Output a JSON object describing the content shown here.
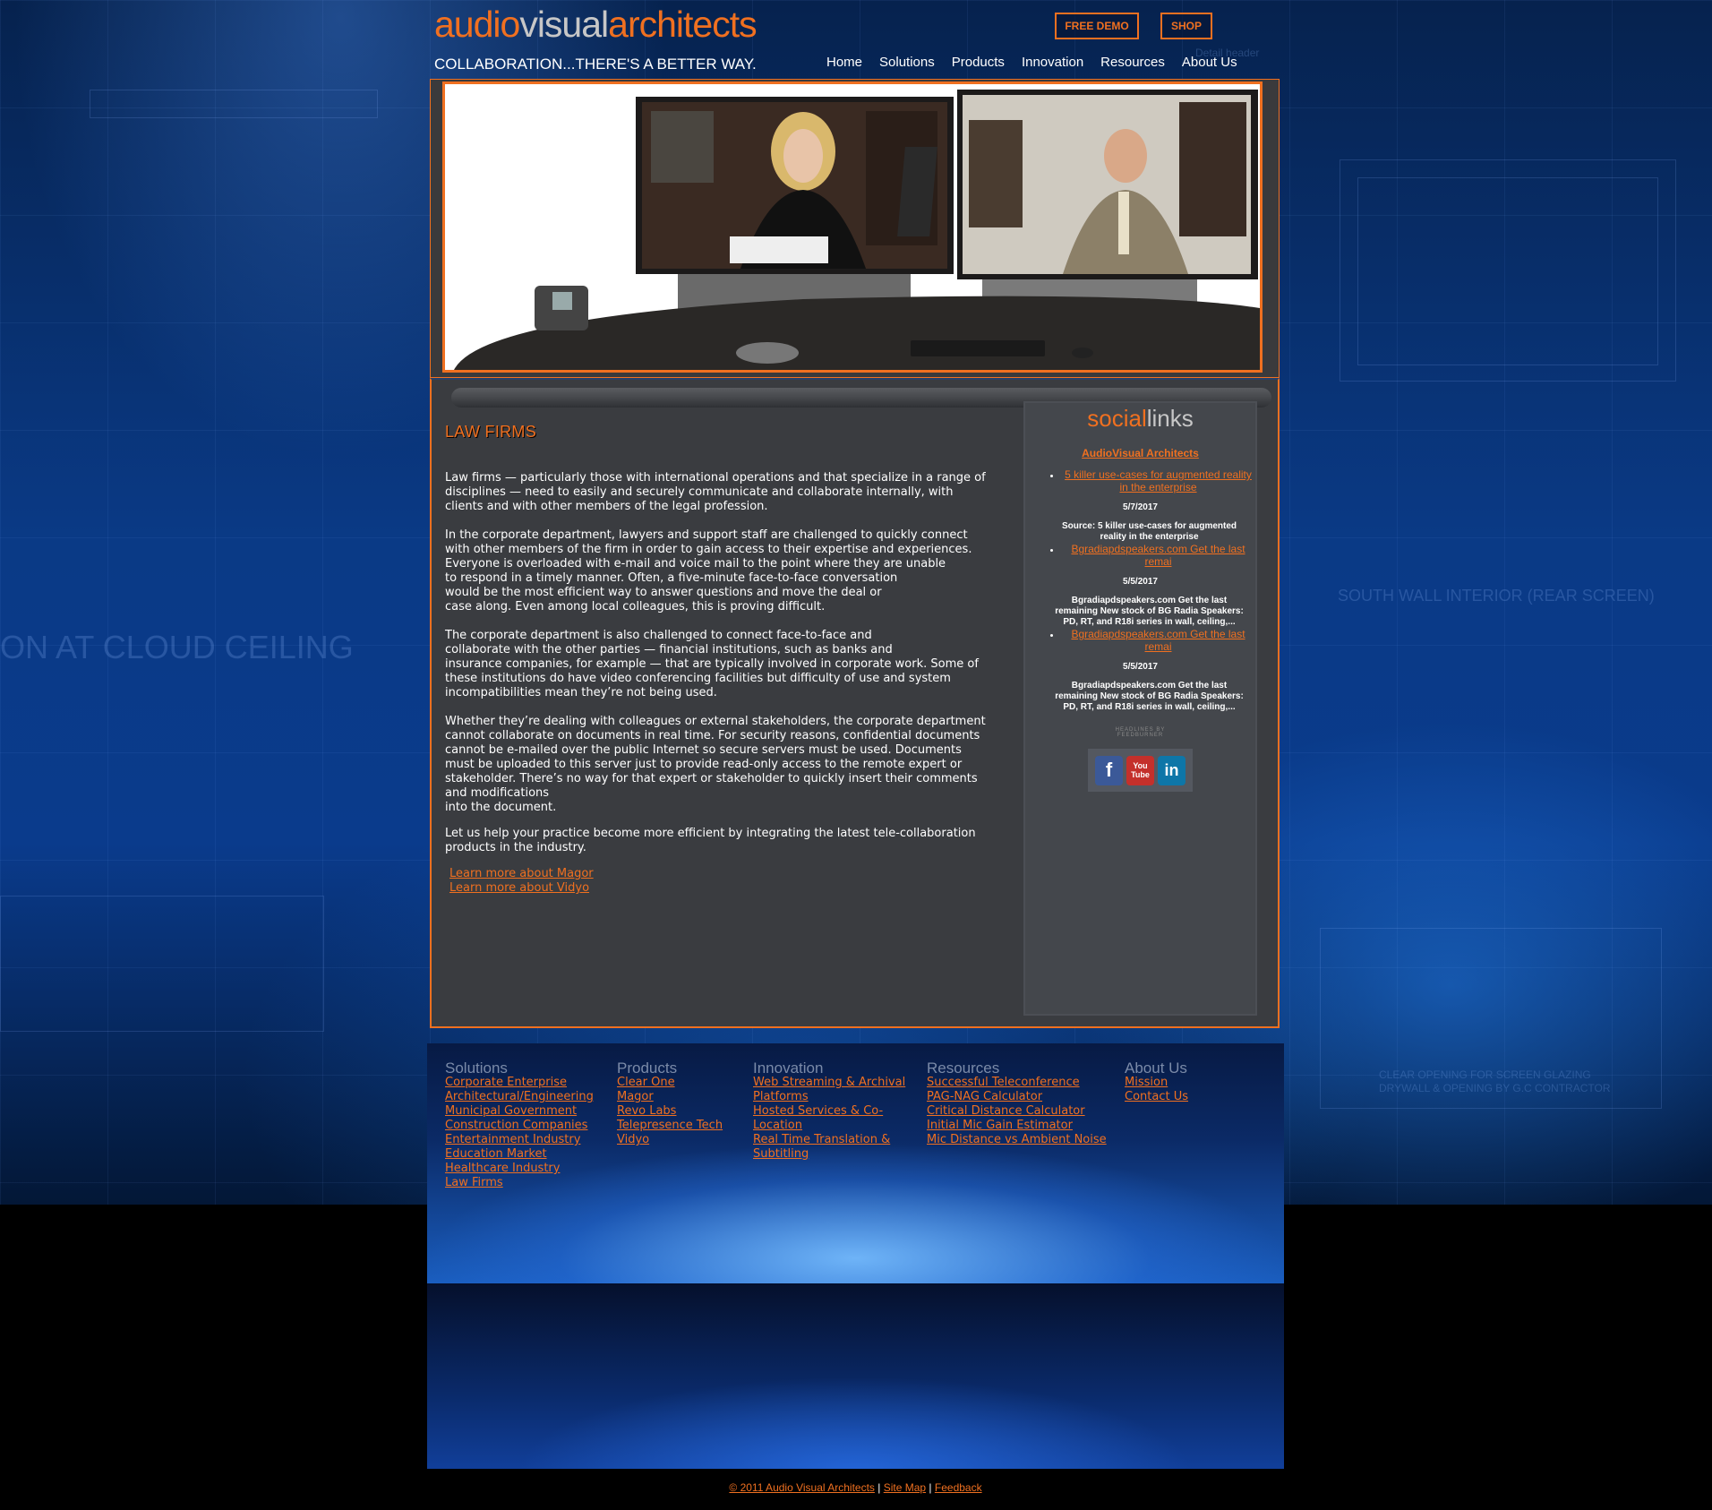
{
  "header": {
    "logo_part1": "audio",
    "logo_part2": "visual",
    "logo_part3": "architects",
    "tagline": "COLLABORATION...THERE'S A BETTER WAY.",
    "free_demo_label": "FREE DEMO",
    "shop_label": "SHOP",
    "nav": [
      "Home",
      "Solutions",
      "Products",
      "Innovation",
      "Resources",
      "About Us"
    ]
  },
  "background_text": {
    "left": "ON AT CLOUD CEILING",
    "right": "SOUTH WALL INTERIOR (REAR SCREEN)",
    "right_bottom_1": "CLEAR OPENING FOR SCREEN GLAZING",
    "right_bottom_2": "DRYWALL & OPENING BY G.C CONTRACTOR",
    "detail": "Detail header"
  },
  "main": {
    "title": "LAW FIRMS",
    "paragraphs": [
      "Law firms — particularly those with international operations and that specialize in a range of disciplines — need to easily and securely communicate and collaborate internally, with clients and with other members of the legal profession.",
      "In the corporate department, lawyers and support staff are challenged to quickly connect with other members of the firm in order to gain access to their expertise and experiences. Everyone is overloaded with e-mail and voice mail to the point where they are unable\nto respond in a timely manner. Often, a five-minute face-to-face conversation\nwould be the most efficient way to answer questions and move the deal or\ncase along.  Even among local colleagues, this is proving difficult.",
      "The corporate department is also challenged to connect face-to-face and\ncollaborate with the other parties — financial institutions, such as banks and\ninsurance companies, for example — that are typically involved in corporate work. Some of these institutions do have video conferencing facilities but difficulty of use and system incompatibilities mean they’re not being used.",
      "Whether they’re dealing with colleagues or external stakeholders, the corporate department cannot collaborate on documents in real time. For security reasons, confidential documents cannot be e-mailed over the public Internet so secure servers must be used. Documents must be uploaded to this server just to provide read-only access to the remote expert or stakeholder. There’s no way for that expert or stakeholder to quickly insert their comments and modifications\ninto the document.",
      "Let us help your practice become more efficient by integrating the latest tele-collaboration products in the industry."
    ],
    "link_magor": "Learn more about Magor",
    "link_vidyo": "Learn more about Vidyo"
  },
  "social": {
    "title_part1": "social",
    "title_part2": "links",
    "feed_title": "AudioVisual Architects",
    "items": [
      {
        "link": "5 killer use-cases for augmented reality in the enterprise",
        "date": "5/7/2017",
        "source": "Source: 5 killer use-cases for augmented reality in the enterprise"
      },
      {
        "link": "Bgradiapdspeakers.com Get the last remai",
        "date": "5/5/2017",
        "source": "Bgradiapdspeakers.com Get the last remaining New stock of BG Radia Speakers: PD, RT, and R18i series in wall, ceiling,..."
      },
      {
        "link": "Bgradiapdspeakers.com Get the last remai",
        "date": "5/5/2017",
        "source": "Bgradiapdspeakers.com Get the last remaining New stock of BG Radia Speakers: PD, RT, and R18i series in wall, ceiling,..."
      }
    ],
    "feedburner": "HEADLINES BY FEEDBURNER",
    "icons": {
      "facebook": "f",
      "youtube": "You Tube",
      "linkedin": "in"
    }
  },
  "footer": {
    "columns": [
      {
        "heading": "Solutions",
        "links": [
          "Corporate Enterprise",
          "Architectural/Engineering",
          "Municipal Government",
          "Construction Companies",
          "Entertainment Industry",
          "Education Market",
          "Healthcare Industry",
          "Law Firms"
        ]
      },
      {
        "heading": "Products",
        "links": [
          "Clear One",
          "Magor",
          "Revo Labs",
          "Telepresence Tech",
          "Vidyo"
        ]
      },
      {
        "heading": "Innovation",
        "links": [
          "Web Streaming & Archival Platforms",
          "Hosted Services & Co-Location",
          "Real Time Translation & Subtitling"
        ]
      },
      {
        "heading": "Resources",
        "links": [
          "Successful Teleconference",
          "PAG-NAG Calculator",
          "Critical Distance Calculator",
          "Initial Mic Gain Estimator",
          "Mic Distance vs Ambient Noise"
        ]
      },
      {
        "heading": "About Us",
        "links": [
          "Mission",
          "Contact Us"
        ]
      }
    ],
    "copyright": "© 2011 Audio Visual Architects",
    "sitemap": "Site Map",
    "feedback": "Feedback",
    "separator": "|"
  },
  "colors": {
    "accent": "#f07020",
    "panel": "#3a3c40",
    "bg_blue": "#0a3a86"
  }
}
